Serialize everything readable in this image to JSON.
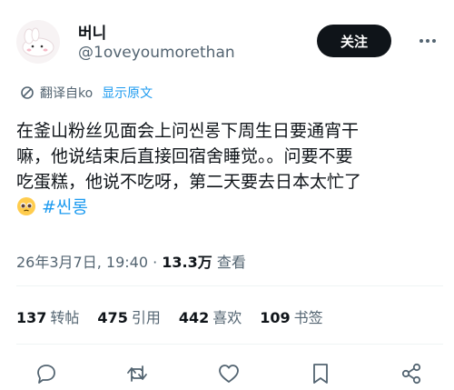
{
  "author": {
    "name": "버니",
    "handle": "@1oveyoumorethan"
  },
  "header": {
    "follow_label": "关注"
  },
  "translation": {
    "label": "翻译自ko",
    "show_original": "显示原文"
  },
  "tweet": {
    "lines": [
      "在釜山粉丝见面会上问씬롱下周生日要通宵干",
      "嘛，他说结束后直接回宿舍睡觉。。问要不要",
      "吃蛋糕，他说不吃呀，第二天要去日本太忙了"
    ],
    "emoji": "pleading-face-icon",
    "hashtag": "#씬롱"
  },
  "meta": {
    "datetime": "26年3月7日, 19:40 · ",
    "views_count": "13.3万",
    "views_label": " 查看"
  },
  "stats": {
    "retweets": {
      "count": "137",
      "label": "转帖"
    },
    "quotes": {
      "count": "475",
      "label": "引用"
    },
    "likes": {
      "count": "442",
      "label": "喜欢"
    },
    "bookmarks": {
      "count": "109",
      "label": "书签"
    }
  },
  "icons": [
    "more-icon",
    "reply-icon",
    "retweet-icon",
    "like-icon",
    "bookmark-icon",
    "share-icon"
  ]
}
